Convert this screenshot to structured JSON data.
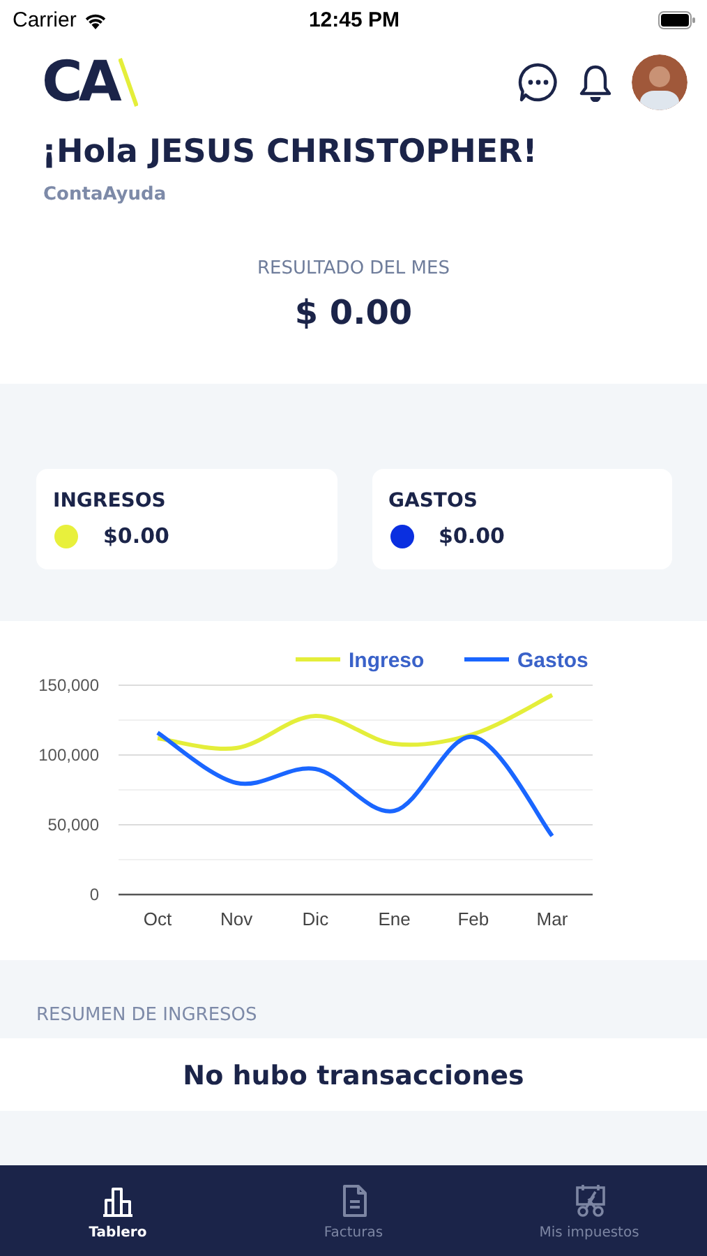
{
  "status_bar": {
    "carrier": "Carrier",
    "time": "12:45 PM"
  },
  "header": {
    "logo": "CA",
    "greeting": "¡Hola JESUS CHRISTOPHER!",
    "company": "ContaAyuda"
  },
  "month_result": {
    "label": "RESULTADO DEL MES",
    "amount": "$ 0.00"
  },
  "cards": [
    {
      "title": "INGRESOS",
      "amount": "$0.00",
      "color": "#e8f03c"
    },
    {
      "title": "GASTOS",
      "amount": "$0.00",
      "color": "#0a2fe0"
    }
  ],
  "chart": {
    "chart_data": {
      "type": "line",
      "categories": [
        "Oct",
        "Nov",
        "Dic",
        "Ene",
        "Feb",
        "Mar"
      ],
      "series": [
        {
          "name": "Ingreso",
          "color": "#e4ee3a",
          "values": [
            112000,
            105000,
            128000,
            108000,
            115000,
            143000
          ]
        },
        {
          "name": "Gastos",
          "color": "#1a66ff",
          "values": [
            116000,
            80000,
            90000,
            60000,
            113000,
            42000
          ]
        }
      ],
      "legend": "top",
      "ylim": [
        0,
        150000
      ],
      "yticks": [
        {
          "value": 0,
          "label": "0"
        },
        {
          "value": 50000,
          "label": "50,000"
        },
        {
          "value": 100000,
          "label": "100,000"
        },
        {
          "value": 150000,
          "label": "150,000"
        }
      ]
    }
  },
  "sections": [
    {
      "title": "RESUMEN DE INGRESOS",
      "message": "No hubo transacciones"
    }
  ],
  "tab_bar": [
    {
      "label": "Tablero",
      "kind": "chart",
      "selected": true
    },
    {
      "label": "Facturas",
      "kind": "document",
      "selected": false
    },
    {
      "label": "Mis impuestos",
      "kind": "taxes",
      "selected": false
    }
  ]
}
